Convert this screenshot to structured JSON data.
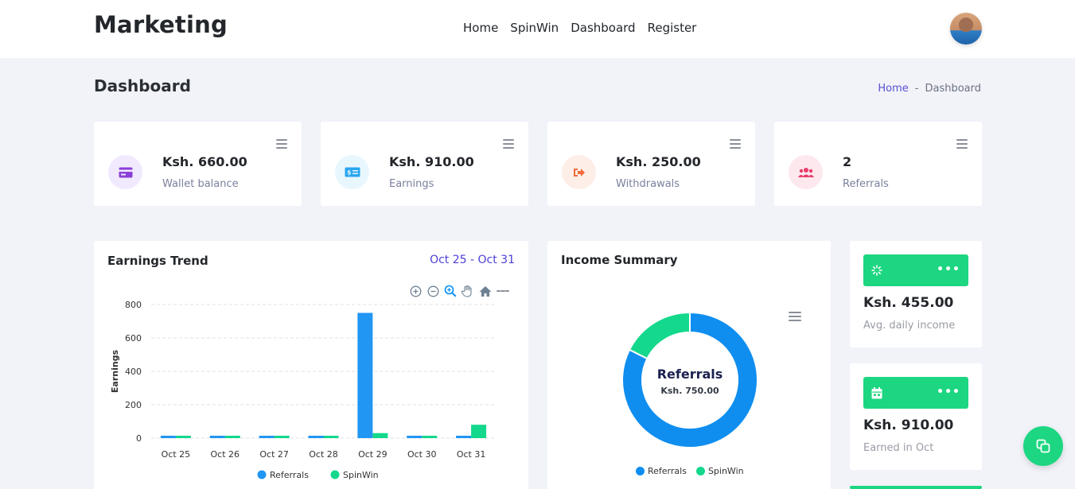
{
  "header": {
    "brand": "Marketing",
    "nav": [
      "Home",
      "SpinWin",
      "Dashboard",
      "Register"
    ]
  },
  "page": {
    "title": "Dashboard",
    "breadcrumb": {
      "home": "Home",
      "separator": "-",
      "current": "Dashboard"
    }
  },
  "stats": [
    {
      "value": "Ksh. 660.00",
      "label": "Wallet balance",
      "icon": "wallet-icon",
      "color": "#8a3fd8",
      "bg": "#f1e9fd"
    },
    {
      "value": "Ksh. 910.00",
      "label": "Earnings",
      "icon": "money-icon",
      "color": "#2aa6f0",
      "bg": "#e8f6fd"
    },
    {
      "value": "Ksh. 250.00",
      "label": "Withdrawals",
      "icon": "sign-out-icon",
      "color": "#f26b3a",
      "bg": "#fdeee8"
    },
    {
      "value": "2",
      "label": "Referrals",
      "icon": "users-icon",
      "color": "#e83d6b",
      "bg": "#fde8ee"
    }
  ],
  "earnings_trend": {
    "title": "Earnings Trend",
    "range": "Oct 25 - Oct 31"
  },
  "income_summary": {
    "title": "Income Summary",
    "center_name": "Referrals",
    "center_value": "Ksh. 750.00"
  },
  "mini_cards": [
    {
      "value": "Ksh. 455.00",
      "label": "Avg. daily income",
      "icon": "spinner-icon",
      "more": "•••"
    },
    {
      "value": "Ksh. 910.00",
      "label": "Earned in Oct",
      "icon": "calendar-icon",
      "more": "•••"
    }
  ],
  "chart_data": [
    {
      "type": "bar",
      "title": "",
      "xlabel": "",
      "ylabel": "Earnings",
      "categories": [
        "Oct 25",
        "Oct 26",
        "Oct 27",
        "Oct 28",
        "Oct 29",
        "Oct 30",
        "Oct 31"
      ],
      "series": [
        {
          "name": "Referrals",
          "values": [
            0,
            0,
            0,
            0,
            750,
            0,
            0
          ],
          "color": "#2196f3"
        },
        {
          "name": "SpinWin",
          "values": [
            0,
            0,
            0,
            0,
            30,
            0,
            80
          ],
          "color": "#14d88c"
        }
      ],
      "ylim": [
        0,
        800
      ],
      "yticks": [
        0,
        200,
        400,
        600,
        800
      ],
      "grid": true,
      "legend": "bottom"
    },
    {
      "type": "pie",
      "variant": "donut",
      "categories": [
        "Referrals",
        "SpinWin"
      ],
      "values": [
        750,
        160
      ],
      "colors": [
        "#0f8ef0",
        "#14d88c"
      ],
      "legend": "bottom"
    }
  ]
}
